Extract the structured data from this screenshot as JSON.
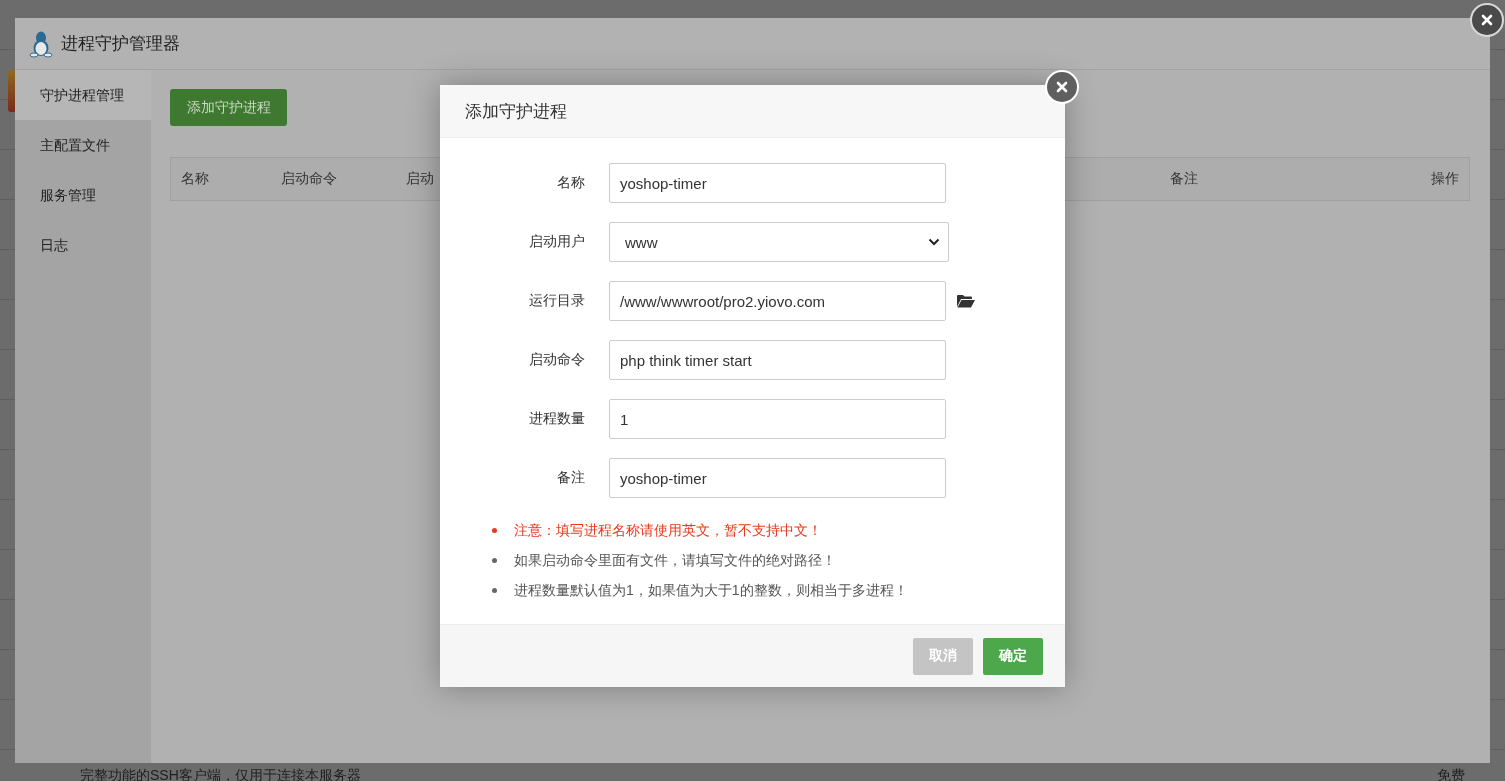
{
  "background_page": {
    "texts": [
      "完整功能的SSH客户端，仅用于连接本服务器",
      "免费"
    ]
  },
  "window": {
    "title": "进程守护管理器"
  },
  "sidebar": {
    "items": [
      {
        "label": "守护进程管理",
        "selected": true
      },
      {
        "label": "主配置文件",
        "selected": false
      },
      {
        "label": "服务管理",
        "selected": false
      },
      {
        "label": "日志",
        "selected": false
      }
    ]
  },
  "toolbar": {
    "add_button": "添加守护进程"
  },
  "table": {
    "columns": [
      "名称",
      "启动命令",
      "启动",
      "备注",
      "操作"
    ]
  },
  "dialog": {
    "title": "添加守护进程",
    "fields": [
      {
        "kind": "text",
        "label": "名称",
        "value": "yoshop-timer"
      },
      {
        "kind": "select",
        "label": "启动用户",
        "value": "www"
      },
      {
        "kind": "path",
        "label": "运行目录",
        "value": "/www/wwwroot/pro2.yiovo.com"
      },
      {
        "kind": "text",
        "label": "启动命令",
        "value": "php think timer start"
      },
      {
        "kind": "text",
        "label": "进程数量",
        "value": "1"
      },
      {
        "kind": "text",
        "label": "备注",
        "value": "yoshop-timer"
      }
    ],
    "notes": [
      {
        "kind": "warning",
        "text": "注意：填写进程名称请使用英文，暂不支持中文！"
      },
      {
        "kind": "info",
        "text": "如果启动命令里面有文件，请填写文件的绝对路径！"
      },
      {
        "kind": "info",
        "text": "进程数量默认值为1，如果值为大于1的整数，则相当于多进程！"
      }
    ],
    "buttons": [
      {
        "kind": "cancel",
        "label": "取消"
      },
      {
        "kind": "confirm",
        "label": "确定"
      }
    ]
  }
}
